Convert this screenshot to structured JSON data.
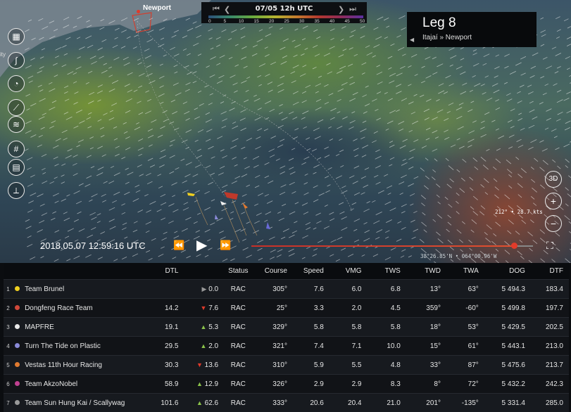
{
  "map": {
    "city": "Newport",
    "side_label": "ity",
    "timebar": {
      "date": "07/05 12h UTC",
      "scale": [
        "0",
        "5",
        "10",
        "15",
        "20",
        "25",
        "30",
        "35",
        "40",
        "45",
        "50"
      ]
    },
    "leg": {
      "title": "Leg 8",
      "route": "Itajaí » Newport"
    },
    "timestamp": "2018.05.07 12:59:16 UTC",
    "cursor_coord": "38°26.85'N • 064°00.96'W",
    "wind_readout": "212° • 28.7 kts",
    "btn_3d": "3D",
    "playback_progress": 0.93
  },
  "table": {
    "headers": [
      "DTL",
      "Status",
      "Course",
      "Speed",
      "VMG",
      "TWS",
      "TWD",
      "TWA",
      "DOG",
      "DTF"
    ],
    "rows": [
      {
        "rank": "1",
        "color": "#f0d020",
        "team": "Team Brunel",
        "dtl": "",
        "delta": "0.0",
        "trend": "flat",
        "status": "RAC",
        "course": "305°",
        "speed": "7.6",
        "vmg": "6.0",
        "tws": "6.8",
        "twd": "13°",
        "twa": "63°",
        "dog": "5 494.3",
        "dtf": "183.4"
      },
      {
        "rank": "2",
        "color": "#d0483a",
        "team": "Dongfeng Race Team",
        "dtl": "14.2",
        "delta": "7.6",
        "trend": "down",
        "status": "RAC",
        "course": "25°",
        "speed": "3.3",
        "vmg": "2.0",
        "tws": "4.5",
        "twd": "359°",
        "twa": "-60°",
        "dog": "5 499.8",
        "dtf": "197.7"
      },
      {
        "rank": "3",
        "color": "#e8e8e8",
        "team": "MAPFRE",
        "dtl": "19.1",
        "delta": "5.3",
        "trend": "up",
        "status": "RAC",
        "course": "329°",
        "speed": "5.8",
        "vmg": "5.8",
        "tws": "5.8",
        "twd": "18°",
        "twa": "53°",
        "dog": "5 429.5",
        "dtf": "202.5"
      },
      {
        "rank": "4",
        "color": "#8a8ad8",
        "team": "Turn The Tide on Plastic",
        "dtl": "29.5",
        "delta": "2.0",
        "trend": "up",
        "status": "RAC",
        "course": "321°",
        "speed": "7.4",
        "vmg": "7.1",
        "tws": "10.0",
        "twd": "15°",
        "twa": "61°",
        "dog": "5 443.1",
        "dtf": "213.0"
      },
      {
        "rank": "5",
        "color": "#e07a30",
        "team": "Vestas 11th Hour Racing",
        "dtl": "30.3",
        "delta": "13.6",
        "trend": "down",
        "status": "RAC",
        "course": "310°",
        "speed": "5.9",
        "vmg": "5.5",
        "tws": "4.8",
        "twd": "33°",
        "twa": "87°",
        "dog": "5 475.6",
        "dtf": "213.7"
      },
      {
        "rank": "6",
        "color": "#c04090",
        "team": "Team AkzoNobel",
        "dtl": "58.9",
        "delta": "12.9",
        "trend": "up",
        "status": "RAC",
        "course": "326°",
        "speed": "2.9",
        "vmg": "2.9",
        "tws": "8.3",
        "twd": "8°",
        "twa": "72°",
        "dog": "5 432.2",
        "dtf": "242.3"
      },
      {
        "rank": "7",
        "color": "#9a9a9a",
        "team": "Team Sun Hung Kai / Scallywag",
        "dtl": "101.6",
        "delta": "62.6",
        "trend": "up",
        "status": "RAC",
        "course": "333°",
        "speed": "20.6",
        "vmg": "20.4",
        "tws": "21.0",
        "twd": "201°",
        "twa": "-135°",
        "dog": "5 331.4",
        "dtf": "285.0"
      }
    ]
  }
}
